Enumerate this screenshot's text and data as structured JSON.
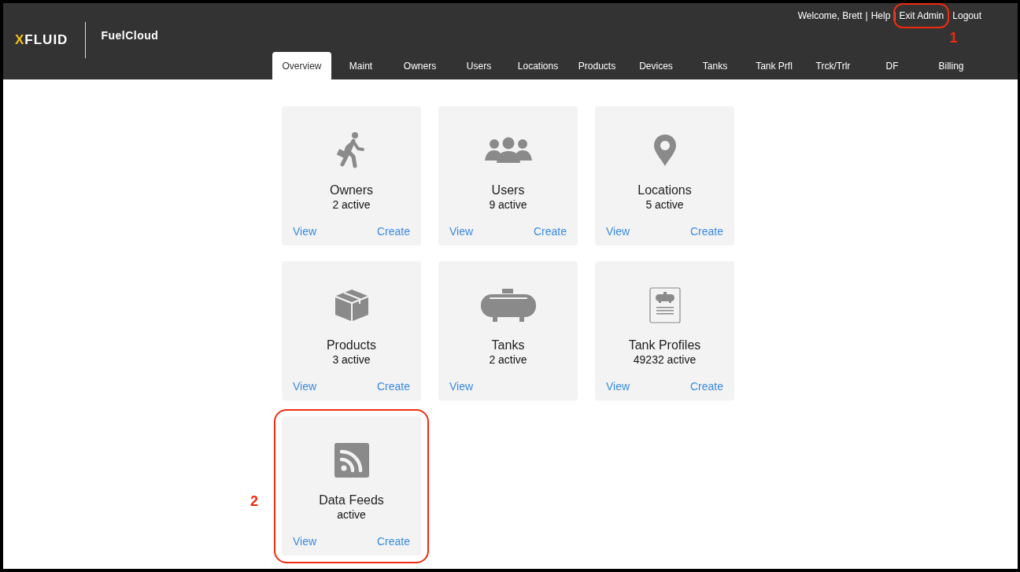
{
  "header": {
    "logo": {
      "accent": "X",
      "rest": "FLUID"
    },
    "app_name": "FuelCloud",
    "separator": "|",
    "welcome": "Welcome, Brett",
    "user_links": [
      {
        "text": "Help"
      },
      {
        "text": "Exit Admin",
        "callout": "1"
      },
      {
        "text": "Logout"
      }
    ]
  },
  "tabs": [
    {
      "label": "Overview",
      "selected": true
    },
    {
      "label": "Maint",
      "selected": false
    },
    {
      "label": "Owners",
      "selected": false
    },
    {
      "label": "Users",
      "selected": false
    },
    {
      "label": "Locations",
      "selected": false
    },
    {
      "label": "Products",
      "selected": false
    },
    {
      "label": "Devices",
      "selected": false
    },
    {
      "label": "Tanks",
      "selected": false
    },
    {
      "label": "Tank Prfl",
      "selected": false
    },
    {
      "label": "Trck/Trlr",
      "selected": false
    },
    {
      "label": "DF",
      "selected": false
    },
    {
      "label": "Billing",
      "selected": false
    }
  ],
  "cards": [
    {
      "kind": "walker",
      "title": "Owners",
      "count": "2 active",
      "links": [
        "View",
        "Create"
      ]
    },
    {
      "kind": "people",
      "title": "Users",
      "count": "9 active",
      "links": [
        "View",
        "Create"
      ]
    },
    {
      "kind": "pin",
      "title": "Locations",
      "count": "5 active",
      "links": [
        "View",
        "Create"
      ]
    },
    {
      "kind": "box",
      "title": "Products",
      "count": "3 active",
      "links": [
        "View",
        "Create"
      ]
    },
    {
      "kind": "tank",
      "title": "Tanks",
      "count": "2 active",
      "links": [
        "View"
      ]
    },
    {
      "kind": "profile",
      "title": "Tank Profiles",
      "count": "49232 active",
      "links": [
        "View",
        "Create"
      ]
    },
    {
      "kind": "feed",
      "title": "Data Feeds",
      "count": "active",
      "links": [
        "View",
        "Create"
      ],
      "callout": "2"
    }
  ]
}
